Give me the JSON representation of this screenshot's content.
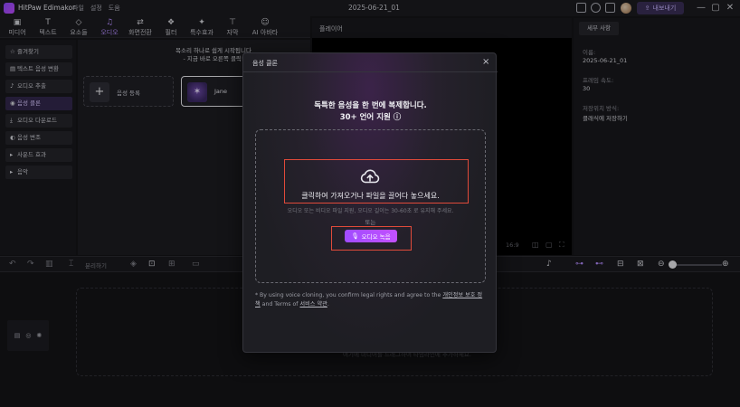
{
  "titlebar": {
    "app_name": "HitPaw Edimakor",
    "menu": [
      "파일",
      "설정",
      "도움"
    ],
    "document_title": "2025-06-21_01",
    "upgrade_label": "내보내기",
    "window_controls": [
      "—",
      "▢",
      "✕"
    ]
  },
  "toolbar": {
    "tabs": [
      {
        "label": "미디어",
        "icon": "media-icon"
      },
      {
        "label": "텍스트",
        "icon": "text-icon"
      },
      {
        "label": "요소들",
        "icon": "elements-icon"
      },
      {
        "label": "오디오",
        "icon": "audio-icon",
        "active": true
      },
      {
        "label": "화면전환",
        "icon": "transition-icon"
      },
      {
        "label": "필터",
        "icon": "filter-icon"
      },
      {
        "label": "특수효과",
        "icon": "effects-icon"
      },
      {
        "label": "자막",
        "icon": "subtitle-icon"
      },
      {
        "label": "AI 아바타",
        "icon": "ai-avatar-icon"
      }
    ]
  },
  "sidebar": {
    "items": [
      {
        "label": "즐겨찾기",
        "icon": "star-icon"
      },
      {
        "label": "텍스트 음성 변환",
        "icon": "tts-icon"
      },
      {
        "label": "오디오 추출",
        "icon": "mic-icon"
      },
      {
        "label": "음성 클론",
        "icon": "voice-clone-icon",
        "active": true
      },
      {
        "label": "오디오 다운로드",
        "icon": "download-icon"
      },
      {
        "label": "음성 변조",
        "icon": "voice-change-icon"
      },
      {
        "label": "사운드 효과",
        "icon": "chevron-right-icon"
      },
      {
        "label": "음악",
        "icon": "chevron-right-icon"
      }
    ]
  },
  "content": {
    "hint_line1": "목소리 하나로 쉽게 시작됩니다",
    "hint_line2": "- 지금 바로 오른쪽 클릭!",
    "add_card_label": "음성 등록",
    "voice_card_label": "Jane"
  },
  "player": {
    "title": "플레이어",
    "ratio_label": "16:9"
  },
  "props": {
    "tab_label": "세부 사항",
    "fields": [
      {
        "label": "이름:",
        "value": "2025-06-21_01"
      },
      {
        "label": "프레임 속도:",
        "value": "30"
      },
      {
        "label": "저장위치 방식:",
        "value": "클래식에 저장하기"
      }
    ]
  },
  "timeline": {
    "split_label": "분리하기",
    "drop_hint": "여기에 미디어를 드래그하여 타임라인에 추가하세요."
  },
  "modal": {
    "title": "음성 클론",
    "close": "×",
    "headline_line1": "독특한 음성을 한 번에 복제합니다.",
    "headline_line2": "30+ 언어 지원 ⓘ",
    "drop_text": "클릭하여 가져오거나 파일을 끌어다 놓으세요.",
    "drop_note": "오디오 또는 비디오 파일 지원, 오디오 길이는 30-60초 로 유지해 주세요.",
    "or_label": "또는",
    "record_button": "오디오 녹음",
    "legal_prefix": "* By using voice cloning, you confirm legal rights and agree to the",
    "legal_link1": "개인정보 보호 정책",
    "legal_mid": "and Terms of",
    "legal_link2": "서비스 약관",
    "legal_suffix": "."
  },
  "colors": {
    "accent": "#b58cff",
    "highlight": "#e04a3a",
    "record_button": "#a04cff"
  }
}
